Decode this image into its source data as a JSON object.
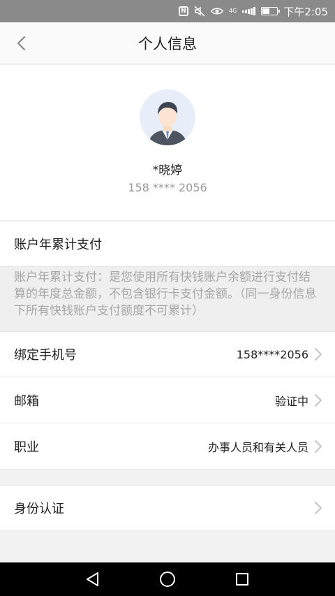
{
  "status_bar": {
    "time": "下午2:05",
    "network": "4G",
    "icons": [
      "nfc-icon",
      "mute-icon",
      "eye-icon",
      "signal-icon",
      "battery-icon"
    ],
    "battery_level": 0.55
  },
  "header": {
    "title": "个人信息",
    "back_icon": "chevron-left-icon"
  },
  "profile": {
    "name": "*晓婷",
    "phone": "158 **** 2056"
  },
  "annual_payment": {
    "label": "账户年累计支付",
    "note": "账户年累计支付：是您使用所有快钱账户余额进行支付结算的年度总金额，不包含银行卡支付金额。（同一身份信息下所有快钱账户支付额度不可累计）"
  },
  "settings": {
    "phone": {
      "label": "绑定手机号",
      "value": "158****2056"
    },
    "email": {
      "label": "邮箱",
      "value": "验证中"
    },
    "occupation": {
      "label": "职业",
      "value": "办事人员和有关人员"
    },
    "identity": {
      "label": "身份认证"
    }
  },
  "colors": {
    "background": "#f2f2f2",
    "card": "#ffffff",
    "muted_text": "#999999",
    "chevron": "#c4c4c4",
    "status_bar": "#8a8a8a",
    "nav_bar": "#000000"
  }
}
